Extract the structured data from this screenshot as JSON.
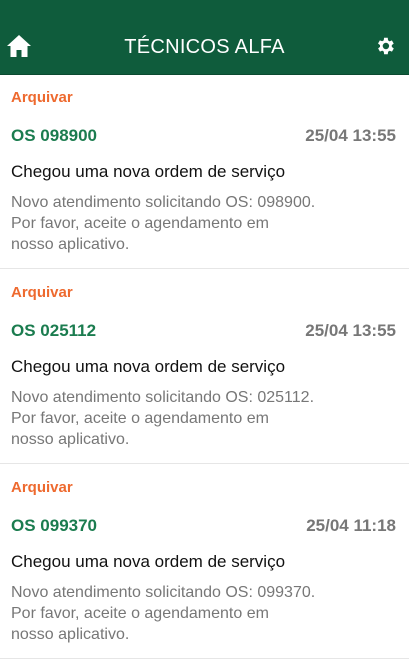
{
  "header": {
    "title": "TÉCNICOS ALFA",
    "home_icon": "home-icon",
    "settings_icon": "gear-icon",
    "background": "#0f5c3c"
  },
  "notifications": [
    {
      "archive_label": "Arquivar",
      "os_number": "OS 098900",
      "timestamp": "25/04 13:55",
      "title": "Chegou uma nova ordem de serviço",
      "body_lines": [
        "Novo atendimento solicitando OS: 098900.",
        "Por favor, aceite o agendamento em",
        "nosso aplicativo."
      ]
    },
    {
      "archive_label": "Arquivar",
      "os_number": "OS 025112",
      "timestamp": "25/04 13:55",
      "title": "Chegou uma nova ordem de serviço",
      "body_lines": [
        "Novo atendimento solicitando OS: 025112.",
        "Por favor, aceite o agendamento em",
        "nosso aplicativo."
      ]
    },
    {
      "archive_label": "Arquivar",
      "os_number": "OS 099370",
      "timestamp": "25/04 11:18",
      "title": "Chegou uma nova ordem de serviço",
      "body_lines": [
        "Novo atendimento solicitando OS: 099370.",
        "Por favor, aceite o agendamento em",
        "nosso aplicativo."
      ]
    }
  ],
  "colors": {
    "archive": "#ee6a2f",
    "os_number": "#1b7c4f",
    "muted": "#777777"
  }
}
